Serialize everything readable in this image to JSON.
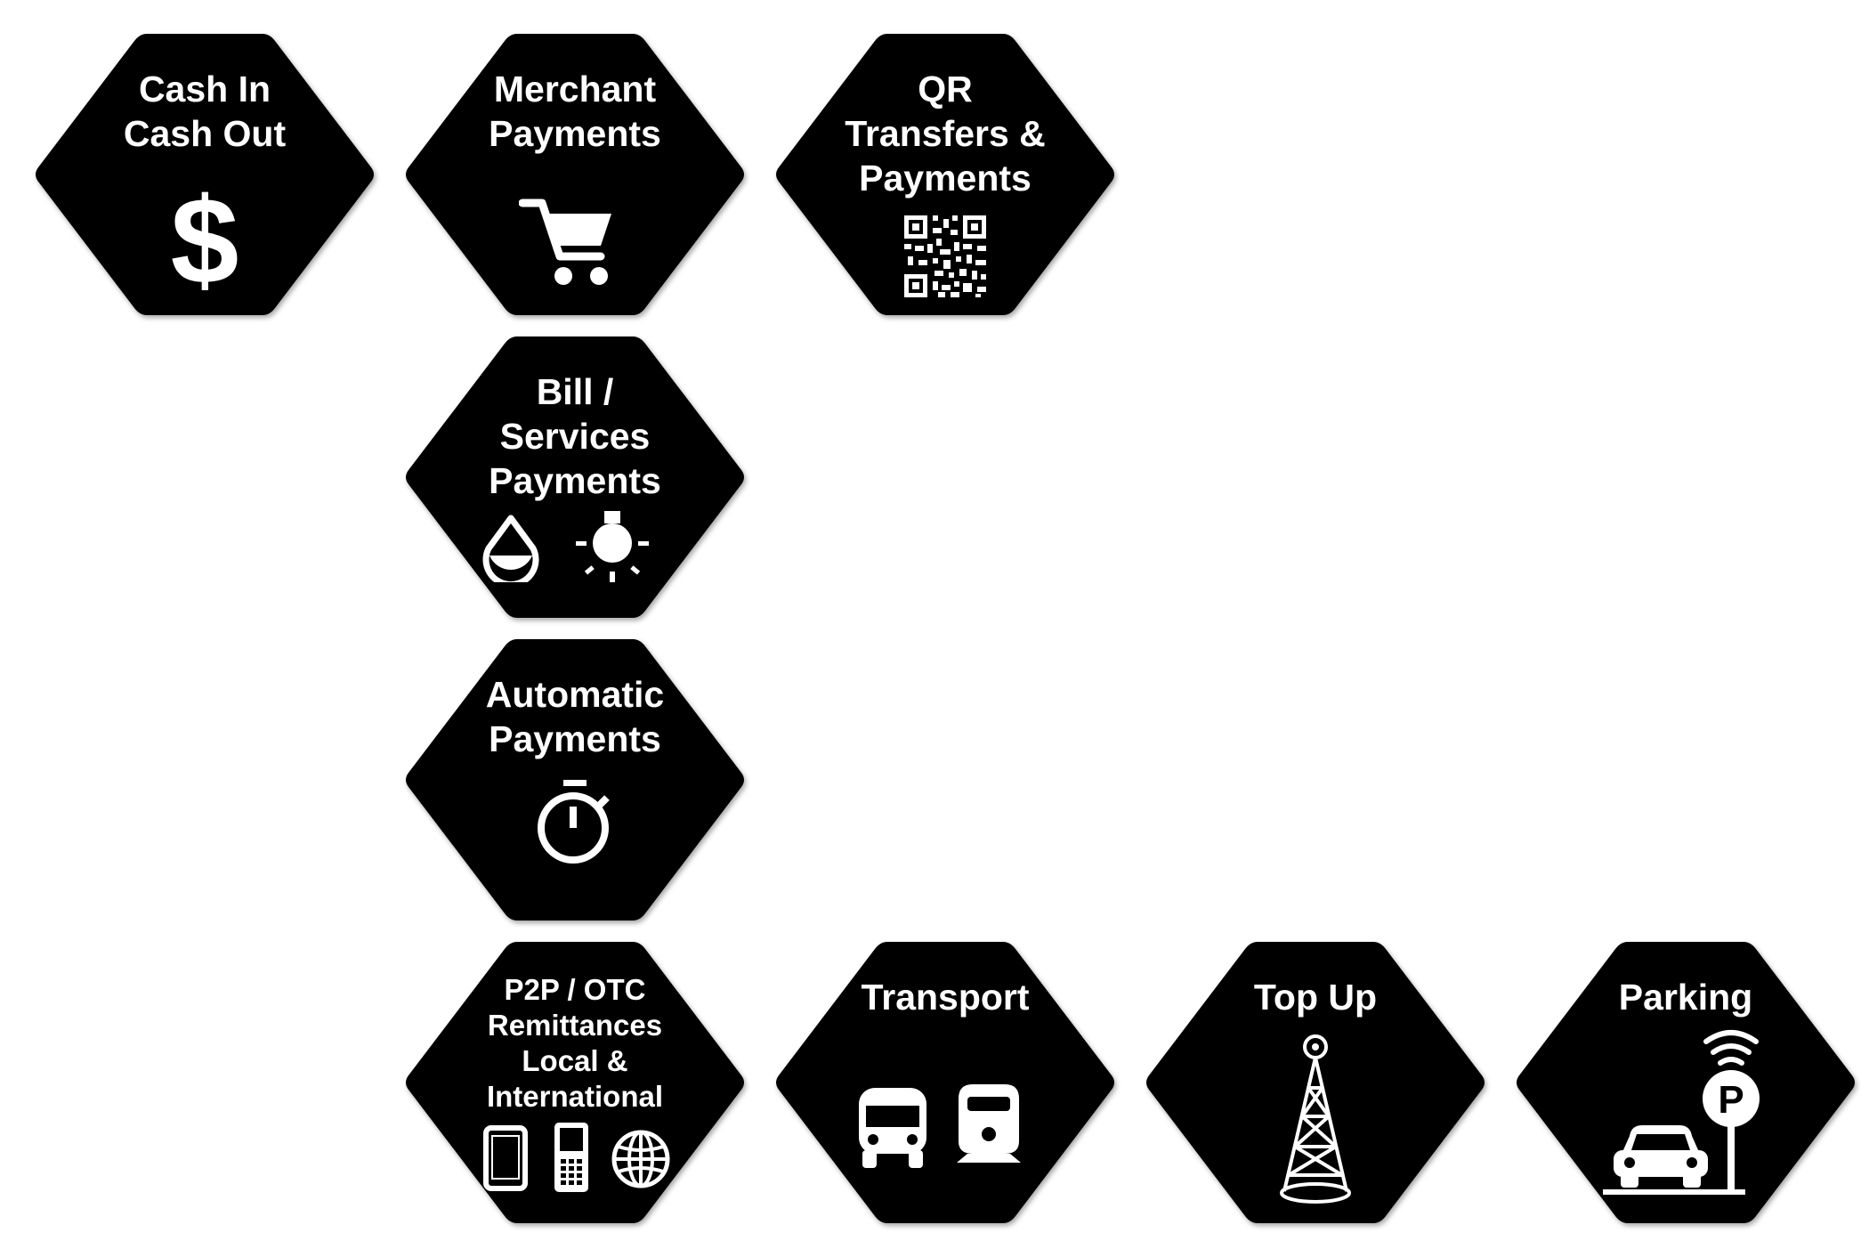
{
  "colors": {
    "hex_fill": "#000000",
    "text": "#ffffff",
    "background": "#ffffff"
  },
  "tiles": [
    {
      "lines": [
        "Cash In",
        "Cash Out"
      ],
      "icons": [
        "dollar-icon"
      ]
    },
    {
      "lines": [
        "Merchant",
        "Payments"
      ],
      "icons": [
        "shopping-cart-icon"
      ]
    },
    {
      "lines": [
        "QR",
        "Transfers &",
        "Payments"
      ],
      "icons": [
        "qr-code-icon"
      ]
    },
    {
      "lines": [
        "Bill /",
        "Services",
        "Payments"
      ],
      "icons": [
        "water-drop-icon",
        "light-bulb-icon"
      ]
    },
    {
      "lines": [
        "Automatic",
        "Payments"
      ],
      "icons": [
        "stopwatch-icon"
      ]
    },
    {
      "lines": [
        "P2P / OTC",
        "Remittances",
        "Local &",
        "International"
      ],
      "icons": [
        "tablet-icon",
        "mobile-phone-icon",
        "globe-icon"
      ]
    },
    {
      "lines": [
        "Transport"
      ],
      "icons": [
        "bus-icon",
        "train-icon"
      ]
    },
    {
      "lines": [
        "Top Up"
      ],
      "icons": [
        "radio-tower-icon"
      ]
    },
    {
      "lines": [
        "Parking"
      ],
      "icons": [
        "car-icon",
        "parking-sign-icon"
      ]
    }
  ]
}
